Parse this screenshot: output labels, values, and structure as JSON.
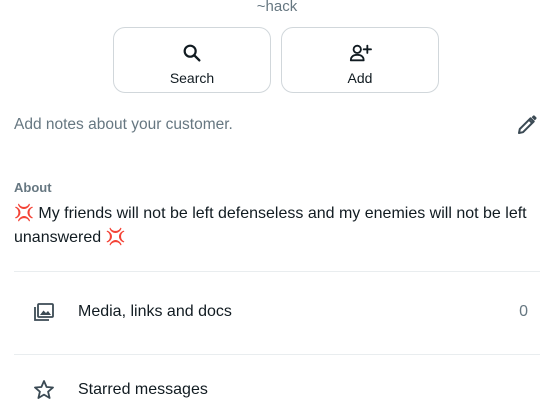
{
  "contact": {
    "username": "~hack"
  },
  "actions": {
    "search_label": "Search",
    "add_label": "Add"
  },
  "notes": {
    "placeholder": "Add notes about your customer."
  },
  "about": {
    "heading": "About",
    "text": "💢 My friends will not be left defenseless and my enemies will not be left unanswered 💢"
  },
  "rows": {
    "media": {
      "label": "Media, links and docs",
      "count": "0"
    },
    "starred": {
      "label": "Starred messages"
    }
  },
  "icons": {
    "search": "search-icon",
    "add": "add-person-icon",
    "edit": "pencil-icon",
    "media": "media-folder-icon",
    "starred": "star-icon"
  },
  "colors": {
    "primary_text": "#111b21",
    "secondary_text": "#667781",
    "icon": "#3b4a54",
    "border": "#d1d7db",
    "divider": "#e9edef"
  }
}
